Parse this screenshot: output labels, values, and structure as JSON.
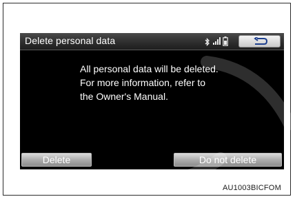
{
  "screen": {
    "title": "Delete personal data",
    "message_lines": [
      "All personal data will be deleted.",
      "For more information, refer to",
      "the Owner's Manual."
    ],
    "status_icons": [
      "bluetooth-icon",
      "signal-strength-icon",
      "battery-icon"
    ],
    "back_icon": "return-arrow-icon",
    "buttons": {
      "delete_label": "Delete",
      "keep_label": "Do not delete"
    }
  },
  "figure_code": "AU1003BICFOM",
  "colors": {
    "screen_bg": "#000000",
    "button_gradient_top": "#dcdcdc",
    "button_gradient_bottom": "#8d8d8d",
    "text": "#ffffff"
  }
}
